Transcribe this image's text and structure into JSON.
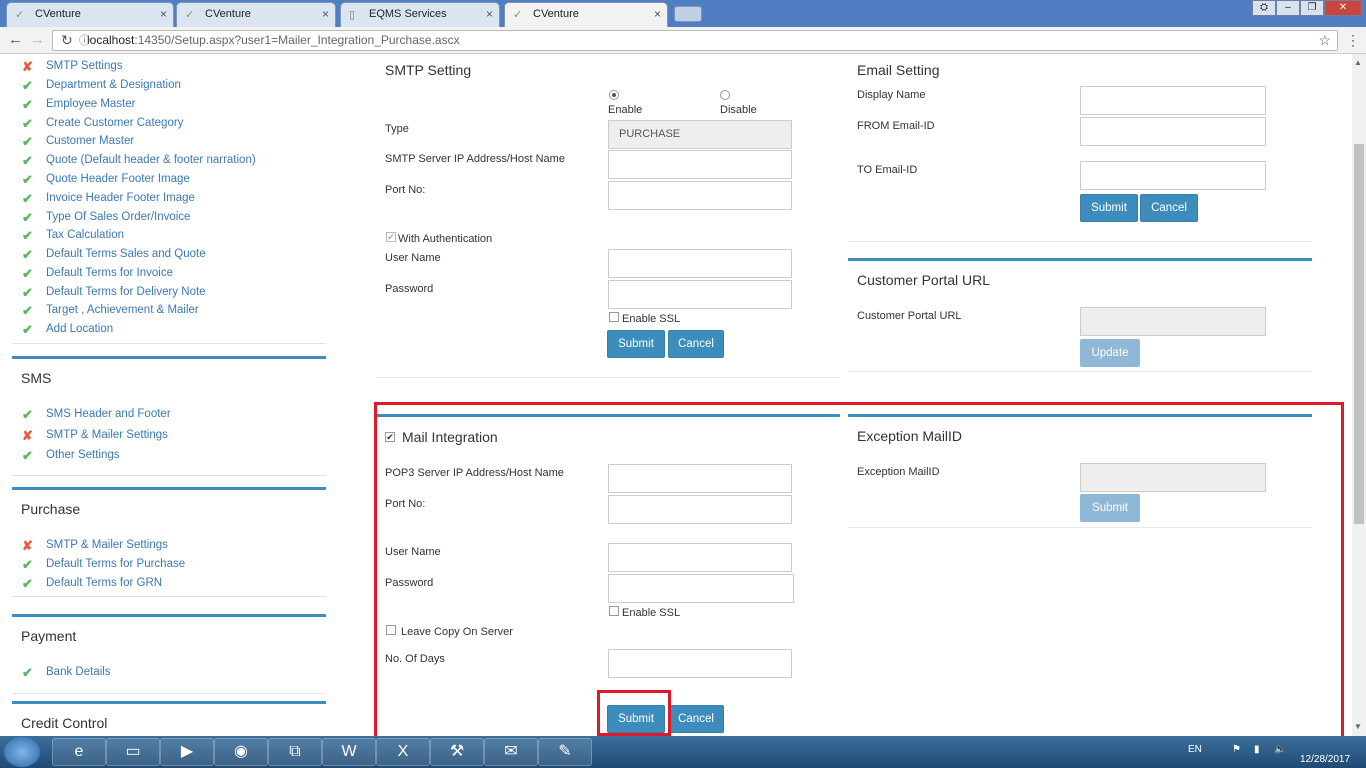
{
  "browser": {
    "tabs": [
      {
        "label": "CVenture"
      },
      {
        "label": "CVenture"
      },
      {
        "label": "EQMS Services"
      },
      {
        "label": "CVenture"
      }
    ],
    "url_host": "localhost",
    "url_path": ":14350/Setup.aspx?user1=Mailer_Integration_Purchase.ascx"
  },
  "sidebar": {
    "setup_items": [
      {
        "label": "SMTP Settings",
        "status": "x"
      },
      {
        "label": "Department & Designation",
        "status": "check"
      },
      {
        "label": "Employee Master",
        "status": "check"
      },
      {
        "label": "Create Customer Category",
        "status": "check"
      },
      {
        "label": "Customer Master",
        "status": "check"
      },
      {
        "label": "Quote (Default header & footer narration)",
        "status": "check"
      },
      {
        "label": "Quote Header Footer Image",
        "status": "check"
      },
      {
        "label": "Invoice Header Footer Image",
        "status": "check"
      },
      {
        "label": "Type Of Sales Order/Invoice",
        "status": "check"
      },
      {
        "label": "Tax Calculation",
        "status": "check"
      },
      {
        "label": "Default Terms Sales and Quote",
        "status": "check"
      },
      {
        "label": "Default Terms for Invoice",
        "status": "check"
      },
      {
        "label": "Default Terms for Delivery Note",
        "status": "check"
      },
      {
        "label": "Target , Achievement & Mailer",
        "status": "check"
      },
      {
        "label": "Add Location",
        "status": "check"
      }
    ],
    "sms": {
      "title": "SMS",
      "items": [
        {
          "label": "SMS Header and Footer",
          "status": "check"
        },
        {
          "label": "SMTP & Mailer Settings",
          "status": "x"
        },
        {
          "label": "Other Settings",
          "status": "check"
        }
      ]
    },
    "purchase": {
      "title": "Purchase",
      "items": [
        {
          "label": "SMTP & Mailer Settings",
          "status": "x"
        },
        {
          "label": "Default Terms for Purchase",
          "status": "check"
        },
        {
          "label": "Default Terms for GRN",
          "status": "check"
        }
      ]
    },
    "payment": {
      "title": "Payment",
      "items": [
        {
          "label": "Bank Details",
          "status": "check"
        }
      ]
    },
    "credit": {
      "title": "Credit Control"
    }
  },
  "smtp": {
    "title": "SMTP Setting",
    "enable_label": "Enable",
    "disable_label": "Disable",
    "type_label": "Type",
    "type_value": "PURCHASE",
    "server_label": "SMTP Server IP Address/Host Name",
    "port_label": "Port No:",
    "auth_label": "With Authentication",
    "user_label": "User Name",
    "password_label": "Password",
    "ssl_label": "Enable SSL",
    "submit": "Submit",
    "cancel": "Cancel"
  },
  "email": {
    "title": "Email Setting",
    "display_label": "Display Name",
    "from_label": "FROM Email-ID",
    "to_label": "TO Email-ID",
    "submit": "Submit",
    "cancel": "Cancel"
  },
  "portal": {
    "title": "Customer Portal URL",
    "label": "Customer Portal URL",
    "update": "Update"
  },
  "mail": {
    "title": "Mail Integration",
    "pop3_label": "POP3 Server IP Address/Host Name",
    "port_label": "Port No:",
    "user_label": "User Name",
    "password_label": "Password",
    "ssl_label": "Enable SSL",
    "leave_label": "Leave Copy On Server",
    "days_label": "No. Of Days",
    "submit": "Submit",
    "cancel": "Cancel"
  },
  "exception": {
    "title": "Exception MailID",
    "label": "Exception MailID",
    "submit": "Submit"
  },
  "taskbar": {
    "lang": "EN",
    "date": "12/28/2017"
  },
  "colors": {
    "accent": "#3c8dbc",
    "highlight": "#e0192a",
    "ok": "#5cb85c",
    "error": "#e85b3c"
  }
}
